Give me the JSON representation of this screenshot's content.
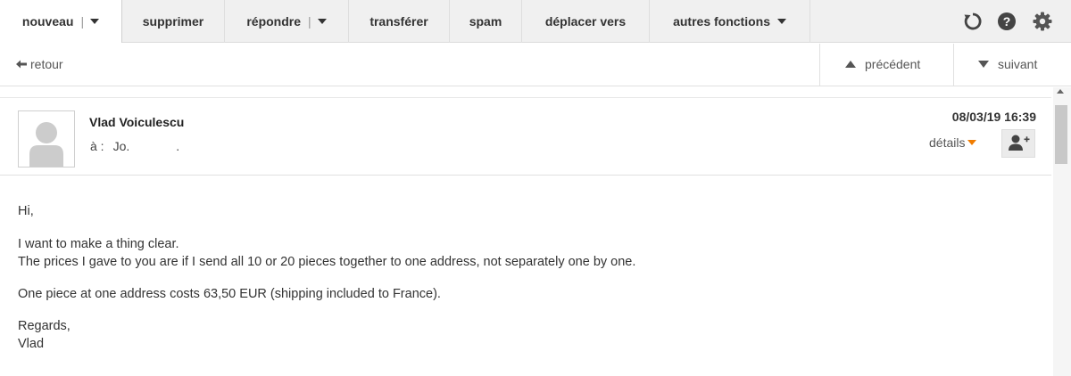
{
  "toolbar": {
    "new_label": "nouveau",
    "pipe": "|",
    "delete_label": "supprimer",
    "reply_label": "répondre",
    "forward_label": "transférer",
    "spam_label": "spam",
    "move_label": "déplacer vers",
    "more_label": "autres fonctions",
    "icons": [
      "refresh-icon",
      "help-icon",
      "settings-icon"
    ]
  },
  "nav": {
    "back_label": "retour",
    "prev_label": "précédent",
    "next_label": "suivant"
  },
  "message": {
    "sender": "Vlad Voiculescu",
    "to_label": "à :",
    "to_value": "Jo.",
    "to_trailing": ".",
    "date": "08/03/19 16:39",
    "details_label": "détails",
    "body": {
      "greeting": "Hi,",
      "line1": "I want to make a thing clear.",
      "line2": "The prices I gave to you are if I send all 10 or 20 pieces together to one address, not separately one by one.",
      "line3": "One piece at one address costs 63,50 EUR (shipping included to France).",
      "closing": "Regards,",
      "signature": "Vlad"
    }
  },
  "colors": {
    "toolbar_bg": "#f0f0f0",
    "accent_orange": "#f07c00",
    "text": "#333333"
  }
}
